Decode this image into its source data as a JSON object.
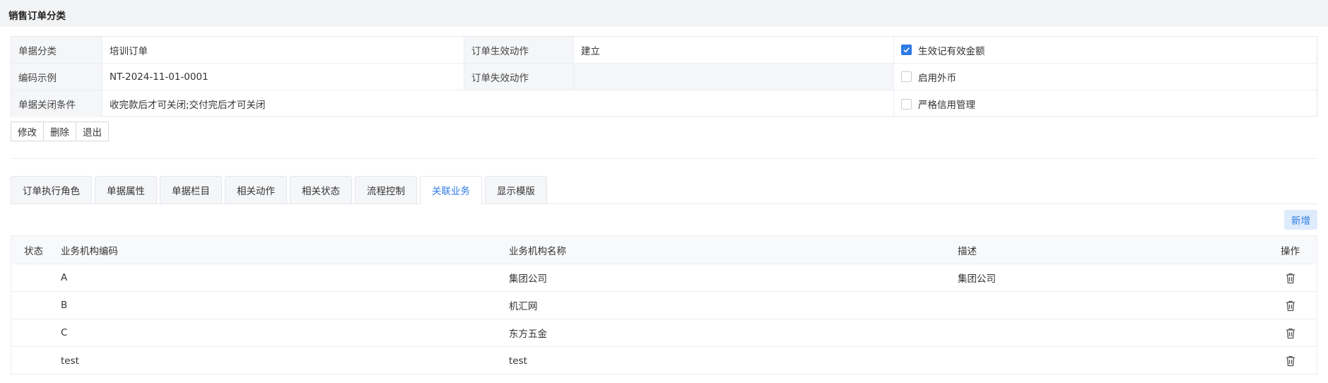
{
  "page": {
    "title": "销售订单分类"
  },
  "info": {
    "row1": {
      "label1": "单据分类",
      "value1": "培训订单",
      "label2": "订单生效动作",
      "value2": "建立",
      "checkbox": {
        "label": "生效记有效金额",
        "checked": true
      }
    },
    "row2": {
      "label1": "编码示例",
      "value1": "NT-2024-11-01-0001",
      "label2": "订单失效动作",
      "value2": "",
      "checkbox": {
        "label": "启用外币",
        "checked": false
      }
    },
    "row3": {
      "label1": "单据关闭条件",
      "value1": "收完款后才可关闭;交付完后才可关闭",
      "checkbox": {
        "label": "严格信用管理",
        "checked": false
      }
    }
  },
  "actions": {
    "edit": "修改",
    "delete": "删除",
    "exit": "退出"
  },
  "tabs": [
    {
      "label": "订单执行角色",
      "active": false
    },
    {
      "label": "单据属性",
      "active": false
    },
    {
      "label": "单据栏目",
      "active": false
    },
    {
      "label": "相关动作",
      "active": false
    },
    {
      "label": "相关状态",
      "active": false
    },
    {
      "label": "流程控制",
      "active": false
    },
    {
      "label": "关联业务",
      "active": true
    },
    {
      "label": "显示模版",
      "active": false
    }
  ],
  "toolbar": {
    "add_label": "新增"
  },
  "table": {
    "columns": {
      "status": "状态",
      "code": "业务机构编码",
      "name": "业务机构名称",
      "desc": "描述",
      "op": "操作"
    },
    "rows": [
      {
        "status": "",
        "code": "A",
        "name": "集团公司",
        "desc": "集团公司"
      },
      {
        "status": "",
        "code": "B",
        "name": "机汇网",
        "desc": ""
      },
      {
        "status": "",
        "code": "C",
        "name": "东方五金",
        "desc": ""
      },
      {
        "status": "",
        "code": "test",
        "name": "test",
        "desc": ""
      }
    ]
  },
  "icons": {
    "check": "check-icon",
    "delete": "trash-icon"
  },
  "colors": {
    "accent": "#2d7be5",
    "header_bg": "#f2f3f5",
    "label_bg": "#f5f6f8",
    "border": "#ebeef5"
  }
}
